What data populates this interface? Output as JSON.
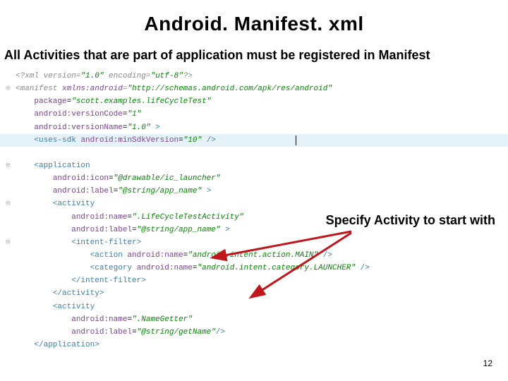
{
  "title": "Android. Manifest. xml",
  "subtitle": "All Activities that are part of application must be registered in Manifest",
  "annotation": "Specify Activity to start with",
  "page_number": "12",
  "xml": {
    "decl_version": "1.0",
    "decl_encoding": "utf-8",
    "manifest_xmlns": "http://schemas.android.com/apk/res/android",
    "package": "scott.examples.lifeCycleTest",
    "versionCode": "1",
    "versionName": "1.0",
    "minSdk": "10",
    "app_icon": "@drawable/ic_launcher",
    "app_label": "@string/app_name",
    "act1_name": ".LifeCycleTestActivity",
    "act1_label": "@string/app_name",
    "action_name": "android.intent.action.MAIN",
    "category_name": "android.intent.category.LAUNCHER",
    "act2_name": ".NameGetter",
    "act2_label": "@string/getName"
  }
}
